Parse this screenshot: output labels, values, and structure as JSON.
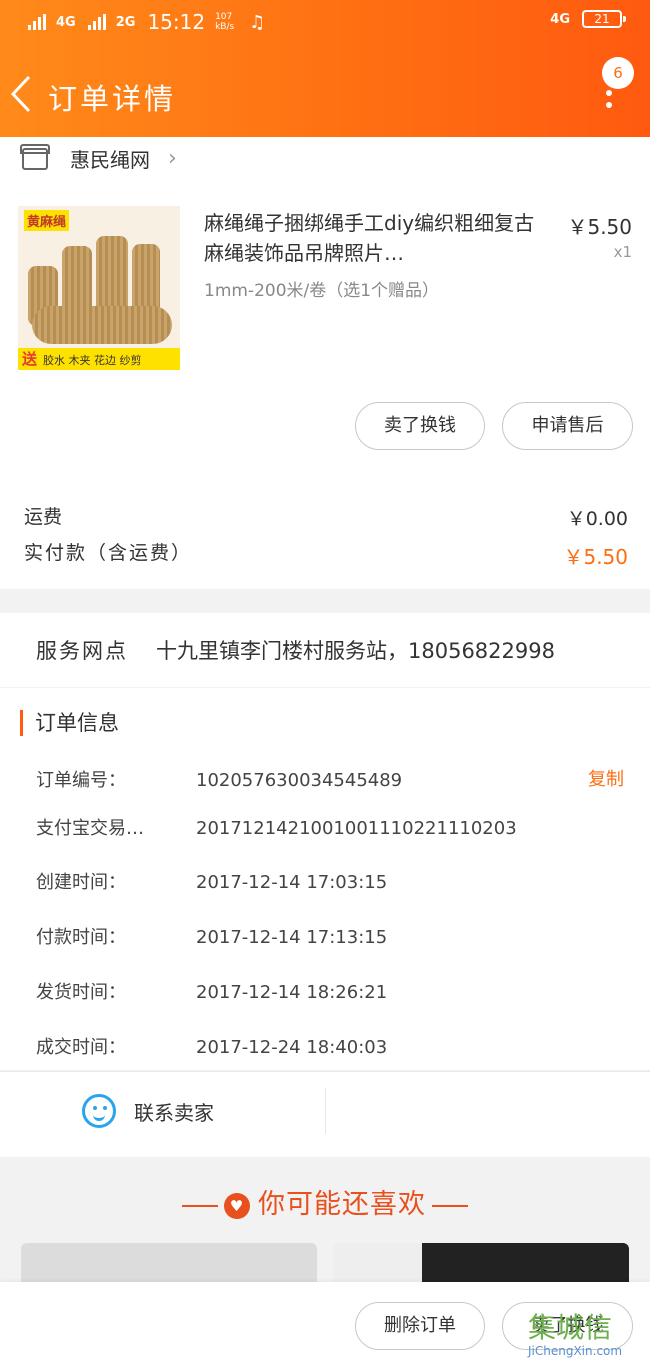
{
  "status_bar": {
    "net1": "4G",
    "net2": "2G",
    "time": "15:12",
    "speed": "107 kB/s",
    "net_right": "4G",
    "battery": "21"
  },
  "header": {
    "title": "订单详情",
    "badge": "6"
  },
  "shop": {
    "name": "惠民绳网"
  },
  "product": {
    "image_tag": "黄麻绳",
    "image_gift": "送",
    "image_gift_items": "胶水 木夹 花边 纱剪",
    "title": "麻绳绳子捆绑绳手工diy编织粗细复古麻绳装饰品吊牌照片…",
    "sku": "1mm-200米/卷（选1个赠品）",
    "price": "￥5.50",
    "qty": "x1"
  },
  "actions": {
    "resell": "卖了换钱",
    "after_sale": "申请售后"
  },
  "fees": {
    "shipping_label": "运费",
    "shipping_value": "￥0.00",
    "paid_label": "实付款（含运费）",
    "paid_value": "￥5.50"
  },
  "service": {
    "label": "服务网点",
    "value": "十九里镇李门楼村服务站，18056822998"
  },
  "order_info": {
    "title": "订单信息",
    "copy": "复制",
    "rows": [
      {
        "key": "订单编号：",
        "value": "102057630034545489"
      },
      {
        "key": "支付宝交易…",
        "value": "2017121421001001110221110203"
      },
      {
        "key": "创建时间：",
        "value": "2017-12-14 17:03:15"
      },
      {
        "key": "付款时间：",
        "value": "2017-12-14 17:13:15"
      },
      {
        "key": "发货时间：",
        "value": "2017-12-14 18:26:21"
      },
      {
        "key": "成交时间：",
        "value": "2017-12-24 18:40:03"
      }
    ]
  },
  "contact": {
    "label": "联系卖家"
  },
  "recommend": {
    "title": "你可能还喜欢"
  },
  "bottom": {
    "delete": "删除订单",
    "resell": "卖了换钱"
  },
  "watermark": {
    "logo": "集城信",
    "url": "JiChengXin.com"
  },
  "colors": {
    "brand": "#ff6d12",
    "accent_text": "#ff6d12",
    "contact_icon": "#2aa4ef"
  }
}
